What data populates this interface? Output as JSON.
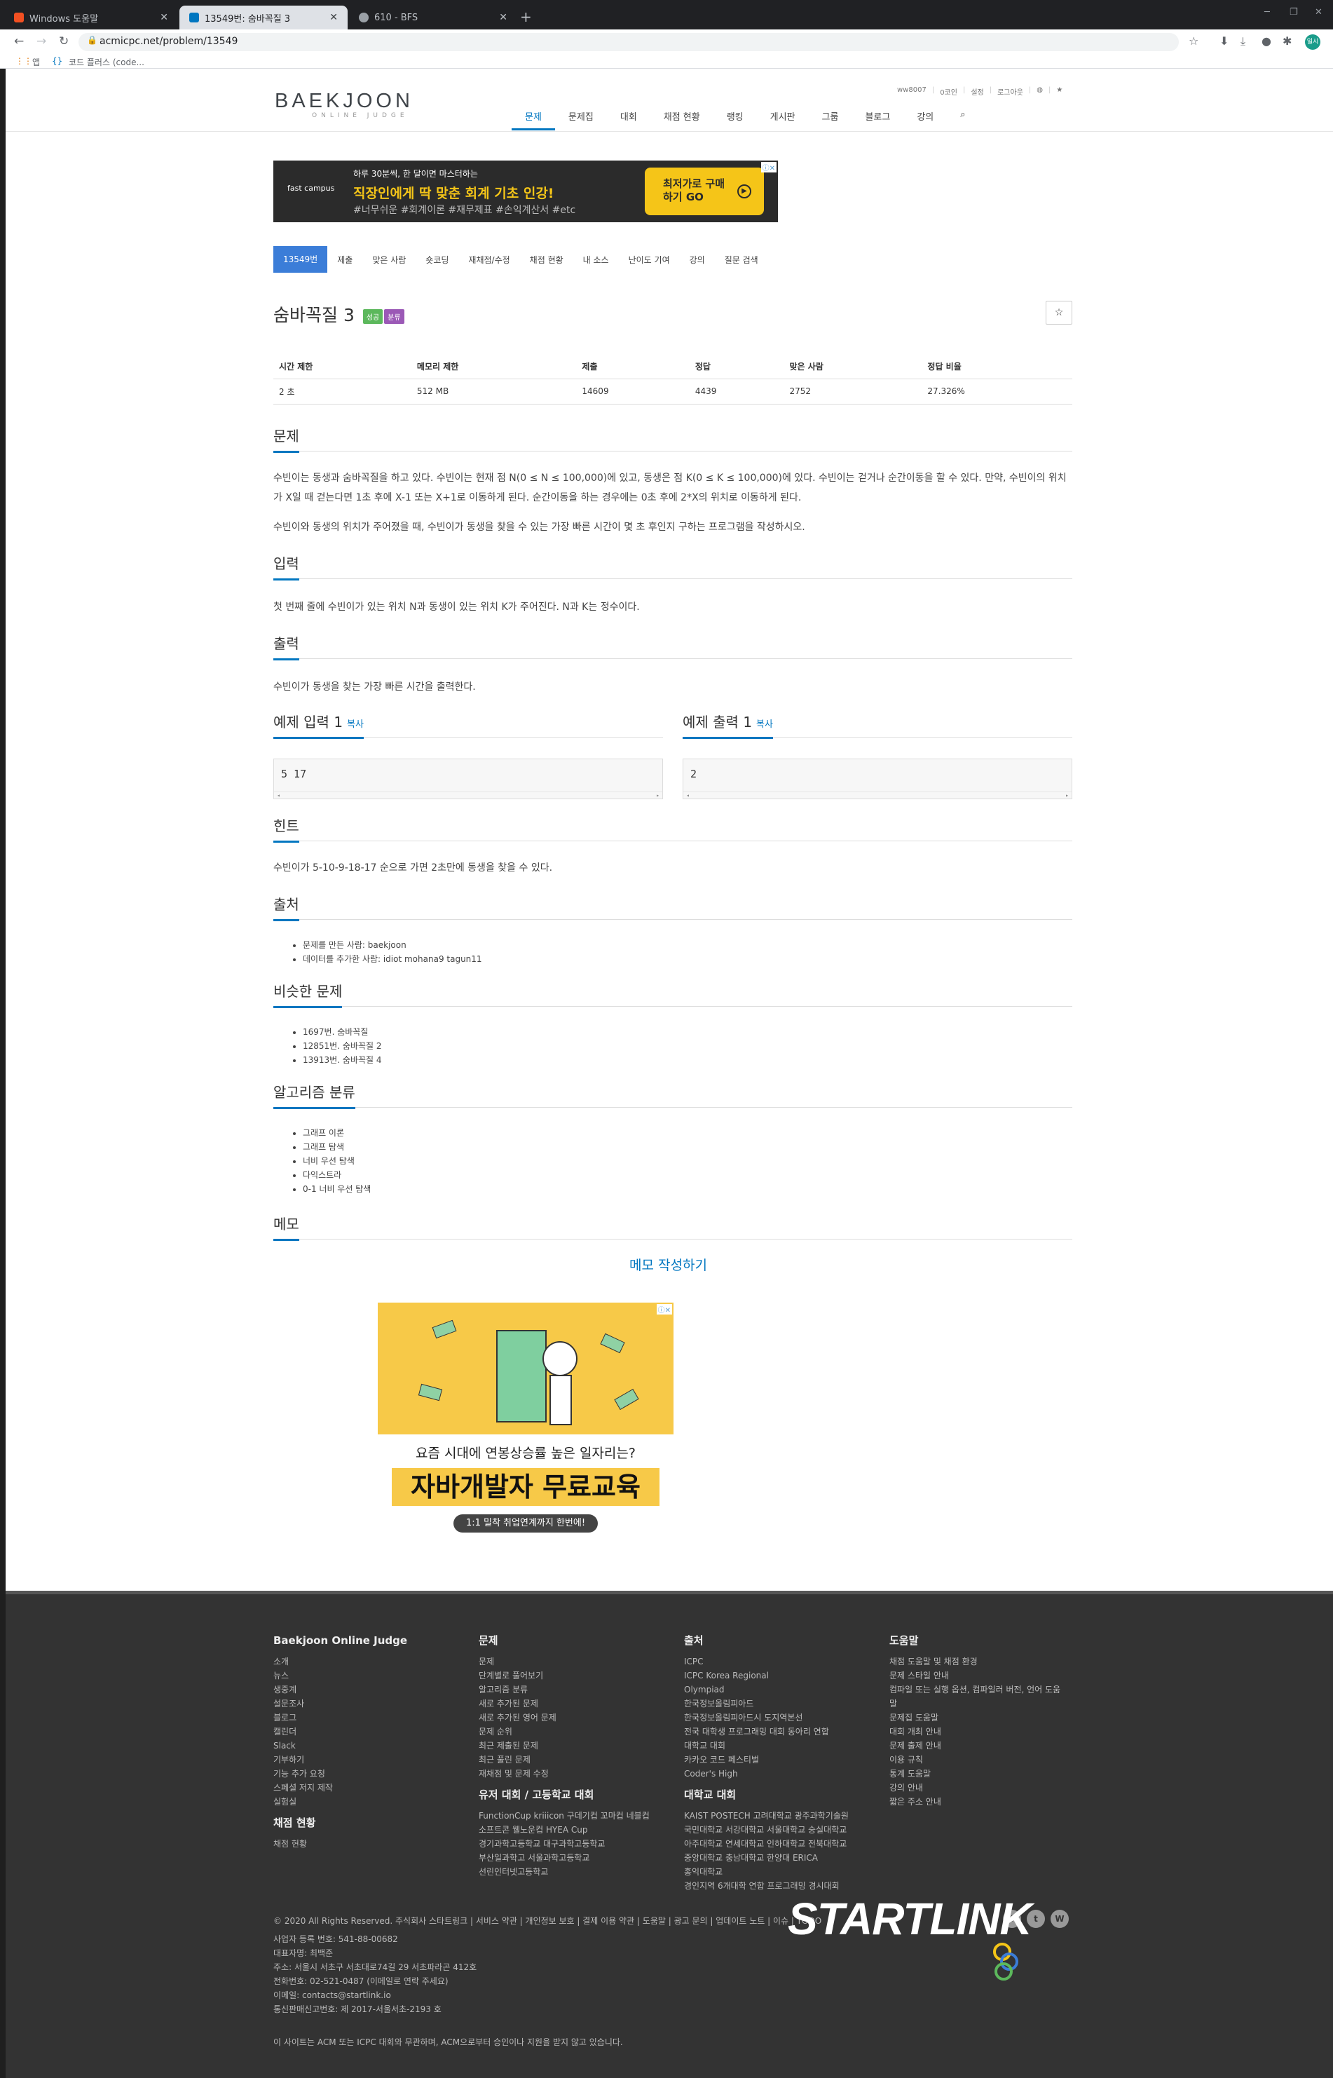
{
  "browser": {
    "tabs": [
      {
        "title": "Windows 도움말",
        "icon_color": "#f25022"
      },
      {
        "title": "13549번: 숨바꼭질 3",
        "icon_color": "#0076c0"
      },
      {
        "title": "610 - BFS",
        "icon_color": "#9aa0a6"
      }
    ],
    "new_tab": "+",
    "url": "acmicpc.net/problem/13549",
    "bookmarks": [
      "앱",
      "코드 플러스 (code..."
    ],
    "profile_label": "일시"
  },
  "site": {
    "logo": "BAEKJOON",
    "logo_k": "K",
    "logo_sub": "ONLINE JUDGE",
    "top_links": [
      "ww8007",
      "0코인",
      "설정",
      "로그아웃"
    ],
    "menu": [
      "문제",
      "문제집",
      "대회",
      "채점 현황",
      "랭킹",
      "게시판",
      "그룹",
      "블로그",
      "강의"
    ]
  },
  "ad_top": {
    "brand": "fast campus",
    "line1": "하루 30분씩, 한 달이면 마스터하는",
    "line2": "직장인에게 딱 맞춘 회계 기초 인강!",
    "line3": "#너무쉬운 #회계이론 #재무제표 #손익계산서 #etc",
    "cta": "최저가로 구매하기 GO"
  },
  "problem_nav": [
    "13549번",
    "제출",
    "맞은 사람",
    "숏코딩",
    "재채점/수정",
    "채점 현황",
    "내 소스",
    "난이도 기여",
    "강의",
    "질문 검색"
  ],
  "problem": {
    "title": "숨바꼭질 3",
    "badges": [
      {
        "label": "성공",
        "color": "#5cb85c"
      },
      {
        "label": "분류",
        "color": "#9b59b6"
      }
    ],
    "info_headers": [
      "시간 제한",
      "메모리 제한",
      "제출",
      "정답",
      "맞은 사람",
      "정답 비율"
    ],
    "info_values": [
      "2 초",
      "512 MB",
      "14609",
      "4439",
      "2752",
      "27.326%"
    ],
    "sections": {
      "desc": "문제",
      "input": "입력",
      "output": "출력",
      "sample_in": "예제 입력 1",
      "sample_out": "예제 출력 1",
      "copy": "복사",
      "hint": "힌트",
      "source": "출처",
      "similar": "비슷한 문제",
      "algo": "알고리즘 분류",
      "memo": "메모"
    },
    "desc_p1": "수빈이는 동생과 숨바꼭질을 하고 있다. 수빈이는 현재 점 N(0 ≤ N ≤ 100,000)에 있고, 동생은 점 K(0 ≤ K ≤ 100,000)에 있다. 수빈이는 걷거나 순간이동을 할 수 있다. 만약, 수빈이의 위치가 X일 때 걷는다면 1초 후에 X-1 또는 X+1로 이동하게 된다. 순간이동을 하는 경우에는 0초 후에 2*X의 위치로 이동하게 된다.",
    "desc_p2": "수빈이와 동생의 위치가 주어졌을 때, 수빈이가 동생을 찾을 수 있는 가장 빠른 시간이 몇 초 후인지 구하는 프로그램을 작성하시오.",
    "input_text": "첫 번째 줄에 수빈이가 있는 위치 N과 동생이 있는 위치 K가 주어진다. N과 K는 정수이다.",
    "output_text": "수빈이가 동생을 찾는 가장 빠른 시간을 출력한다.",
    "sample_input": "5 17",
    "sample_output": "2",
    "hint_text": "수빈이가 5-10-9-18-17 순으로 가면 2초만에 동생을 찾을 수 있다.",
    "source_list": [
      "문제를 만든 사람: baekjoon",
      "데이터를 추가한 사람: idiot mohana9 tagun11"
    ],
    "similar_list": [
      "1697번. 숨바꼭질",
      "12851번. 숨바꼭질 2",
      "13913번. 숨바꼭질 4"
    ],
    "algo_list": [
      "그래프 이론",
      "그래프 탐색",
      "너비 우선 탐색",
      "다익스트라",
      "0-1 너비 우선 탐색"
    ],
    "memo_write": "메모 작성하기"
  },
  "ad_bottom": {
    "line1": "요즘 시대에 연봉상승률 높은 일자리는?",
    "line2": "자바개발자 무료교육",
    "line3": "1:1 밀착 취업연계까지 한번에!"
  },
  "footer": {
    "col1_title": "Baekjoon Online Judge",
    "col1": [
      "소개",
      "뉴스",
      "생중계",
      "설문조사",
      "블로그",
      "캘린더",
      "Slack",
      "기부하기",
      "기능 추가 요청",
      "스페셜 저지 제작",
      "실험실"
    ],
    "col1b_title": "채점 현황",
    "col1b": [
      "채점 현황"
    ],
    "col2_title": "문제",
    "col2": [
      "문제",
      "단계별로 풀어보기",
      "알고리즘 분류",
      "새로 추가된 문제",
      "새로 추가된 영어 문제",
      "문제 순위",
      "최근 제출된 문제",
      "최근 풀린 문제",
      "재채점 및 문제 수정"
    ],
    "col2b_title": "유저 대회 / 고등학교 대회",
    "col2b": [
      "FunctionCup kriiicon 구데기컵 꼬마컵 네블컵",
      "소프트콘 웰노운컵 HYEA Cup",
      "경기과학고등학교 대구과학고등학교",
      "부산일과학고 서울과학고등학교",
      "선린인터넷고등학교"
    ],
    "col3_title": "출처",
    "col3": [
      "ICPC",
      "ICPC Korea Regional",
      "Olympiad",
      "한국정보올림피아드",
      "한국정보올림피아드시 도지역본선",
      "전국 대학생 프로그래밍 대회 동아리 연합",
      "대학교 대회",
      "카카오 코드 페스티벌",
      "Coder's High"
    ],
    "col3b_title": "대학교 대회",
    "col3b": [
      "KAIST POSTECH 고려대학교 광주과학기술원",
      "국민대학교 서강대학교 서울대학교 숭실대학교",
      "아주대학교 연세대학교 인하대학교 전북대학교",
      "중앙대학교 충남대학교 한양대 ERICA",
      "홍익대학교",
      "경인지역 6개대학 연합 프로그래밍 경시대회"
    ],
    "col4_title": "도움말",
    "col4": [
      "채점 도움말 및 채점 환경",
      "문제 스타일 안내",
      "컴파일 또는 실행 옵션, 컴파일러 버전, 언어 도움",
      "말",
      "문제집 도움말",
      "대회 개최 안내",
      "문제 출제 안내",
      "이용 규칙",
      "통계 도움말",
      "강의 안내",
      "짧은 주소 안내"
    ],
    "copyright": "© 2020 All Rights Reserved. 주식회사 스타트링크 | 서비스 약관 | 개인정보 보호 | 결제 이용 약관 | 도움말 | 광고 문의 | 업데이트 노트 | 이슈 | TODO",
    "company": [
      "사업자 등록 번호: 541-88-00682",
      "대표자명: 최백준",
      "주소: 서울시 서초구 서초대로74길 29 서초파라곤 412호",
      "전화번호: 02-521-0487 (이메일로 연락 주세요)",
      "이메일: contacts@startlink.io",
      "통신판매신고번호: 제 2017-서울서초-2193 호"
    ],
    "disclaimer": "이 사이트는 ACM 또는 ICPC 대회와 무관하며, ACM으로부터 승인이나 지원을 받지 않고 있습니다.",
    "brand": "STARTLINK"
  }
}
